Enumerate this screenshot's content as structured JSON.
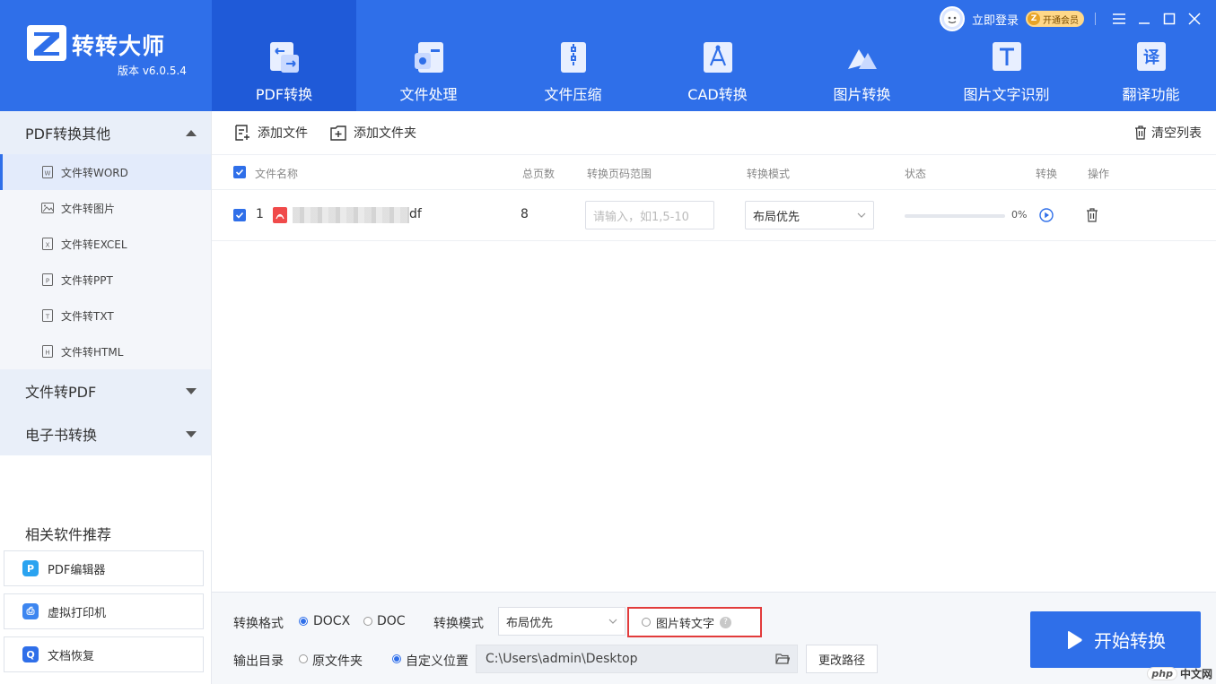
{
  "header": {
    "app_name": "转转大师",
    "version": "版本 v6.0.5.4",
    "login": "立即登录",
    "vip": "开通会员",
    "tabs": [
      {
        "label": "PDF转换",
        "icon": "pdf-convert-icon"
      },
      {
        "label": "文件处理",
        "icon": "file-process-icon"
      },
      {
        "label": "文件压缩",
        "icon": "file-zip-icon"
      },
      {
        "label": "CAD转换",
        "icon": "cad-icon"
      },
      {
        "label": "图片转换",
        "icon": "image-convert-icon"
      },
      {
        "label": "图片文字识别",
        "icon": "ocr-icon"
      },
      {
        "label": "翻译功能",
        "icon": "translate-icon"
      }
    ]
  },
  "sidebar": {
    "groups": [
      {
        "label": "PDF转换其他",
        "expanded": true,
        "items": [
          "文件转WORD",
          "文件转图片",
          "文件转EXCEL",
          "文件转PPT",
          "文件转TXT",
          "文件转HTML"
        ]
      },
      {
        "label": "文件转PDF",
        "expanded": false
      },
      {
        "label": "电子书转换",
        "expanded": false
      }
    ],
    "related_title": "相关软件推荐",
    "related": [
      "PDF编辑器",
      "虚拟打印机",
      "文档恢复"
    ]
  },
  "toolbar": {
    "add_file": "添加文件",
    "add_folder": "添加文件夹",
    "clear_list": "清空列表"
  },
  "table": {
    "columns": [
      "文件名称",
      "总页数",
      "转换页码范围",
      "转换模式",
      "状态",
      "转换",
      "操作"
    ],
    "row": {
      "index": "1",
      "filename_suffix": "df",
      "pages": "8",
      "range_placeholder": "请输入，如1,5-10",
      "mode": "布局优先",
      "progress_percent": 0,
      "progress_label": "0%"
    }
  },
  "bottom": {
    "format_label": "转换格式",
    "format_options": [
      "DOCX",
      "DOC"
    ],
    "format_selected": "DOCX",
    "mode_label": "转换模式",
    "mode_value": "布局优先",
    "ocr_label": "图片转文字",
    "help": "?",
    "output_label": "输出目录",
    "output_options": [
      "原文件夹",
      "自定义位置"
    ],
    "output_selected": "自定义位置",
    "path": "C:\\Users\\admin\\Desktop",
    "change_path": "更改路径",
    "start": "开始转换",
    "watermark_php": "php",
    "watermark_site": "中文网"
  },
  "colors": {
    "primary": "#2f6fe9",
    "primary_dark": "#1f5ad8",
    "highlight_box": "#e23b3b"
  }
}
